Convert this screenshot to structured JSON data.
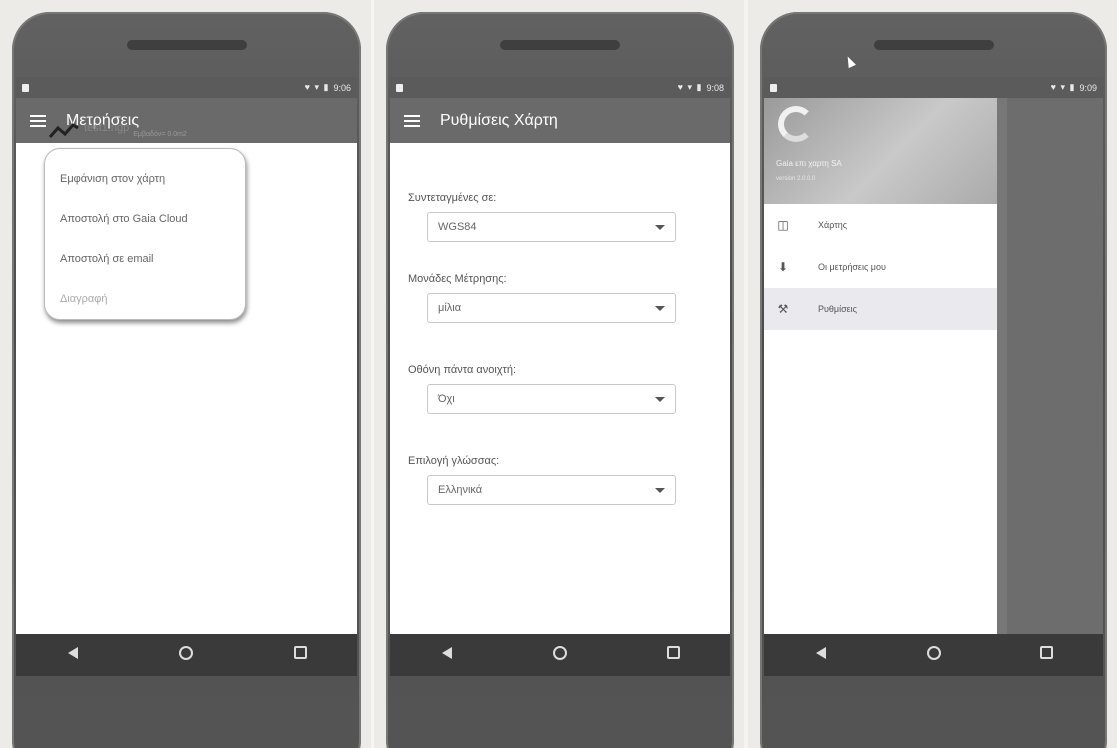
{
  "screens": [
    {
      "status_time": "9:06",
      "title": "Μετρήσεις",
      "file_name": "test1.ngp",
      "file_area": "Εμβαδόν= 0.0m2",
      "menu_items": [
        "Εμφάνιση στον χάρτη",
        "Αποστολή στο Gaia Cloud",
        "Αποστολή σε email",
        "Διαγραφή"
      ]
    },
    {
      "status_time": "9:08",
      "title": "Ρυθμίσεις Χάρτη",
      "settings": [
        {
          "label": "Συντεταγμένες σε:",
          "value": "WGS84"
        },
        {
          "label": "Μονάδες Μέτρησης:",
          "value": "μίλια"
        },
        {
          "label": "Οθόνη πάντα ανοιχτή:",
          "value": "Όχι"
        },
        {
          "label": "Επιλογή γλώσσας:",
          "value": "Ελληνικά"
        }
      ]
    },
    {
      "status_time": "9:09",
      "company": "Gaia επι χαρτη SA",
      "version": "version 2.0.0.0",
      "nav_items": [
        {
          "label": "Χάρτης",
          "icon": "map-icon"
        },
        {
          "label": "Οι μετρήσεις μου",
          "icon": "measurements-icon"
        },
        {
          "label": "Ρυθμίσεις",
          "icon": "settings-wrench-icon",
          "active": true
        }
      ]
    }
  ],
  "status_icons": "♥ ▾ ▮",
  "navbar_icons": [
    "back-icon",
    "home-icon",
    "recents-icon"
  ]
}
